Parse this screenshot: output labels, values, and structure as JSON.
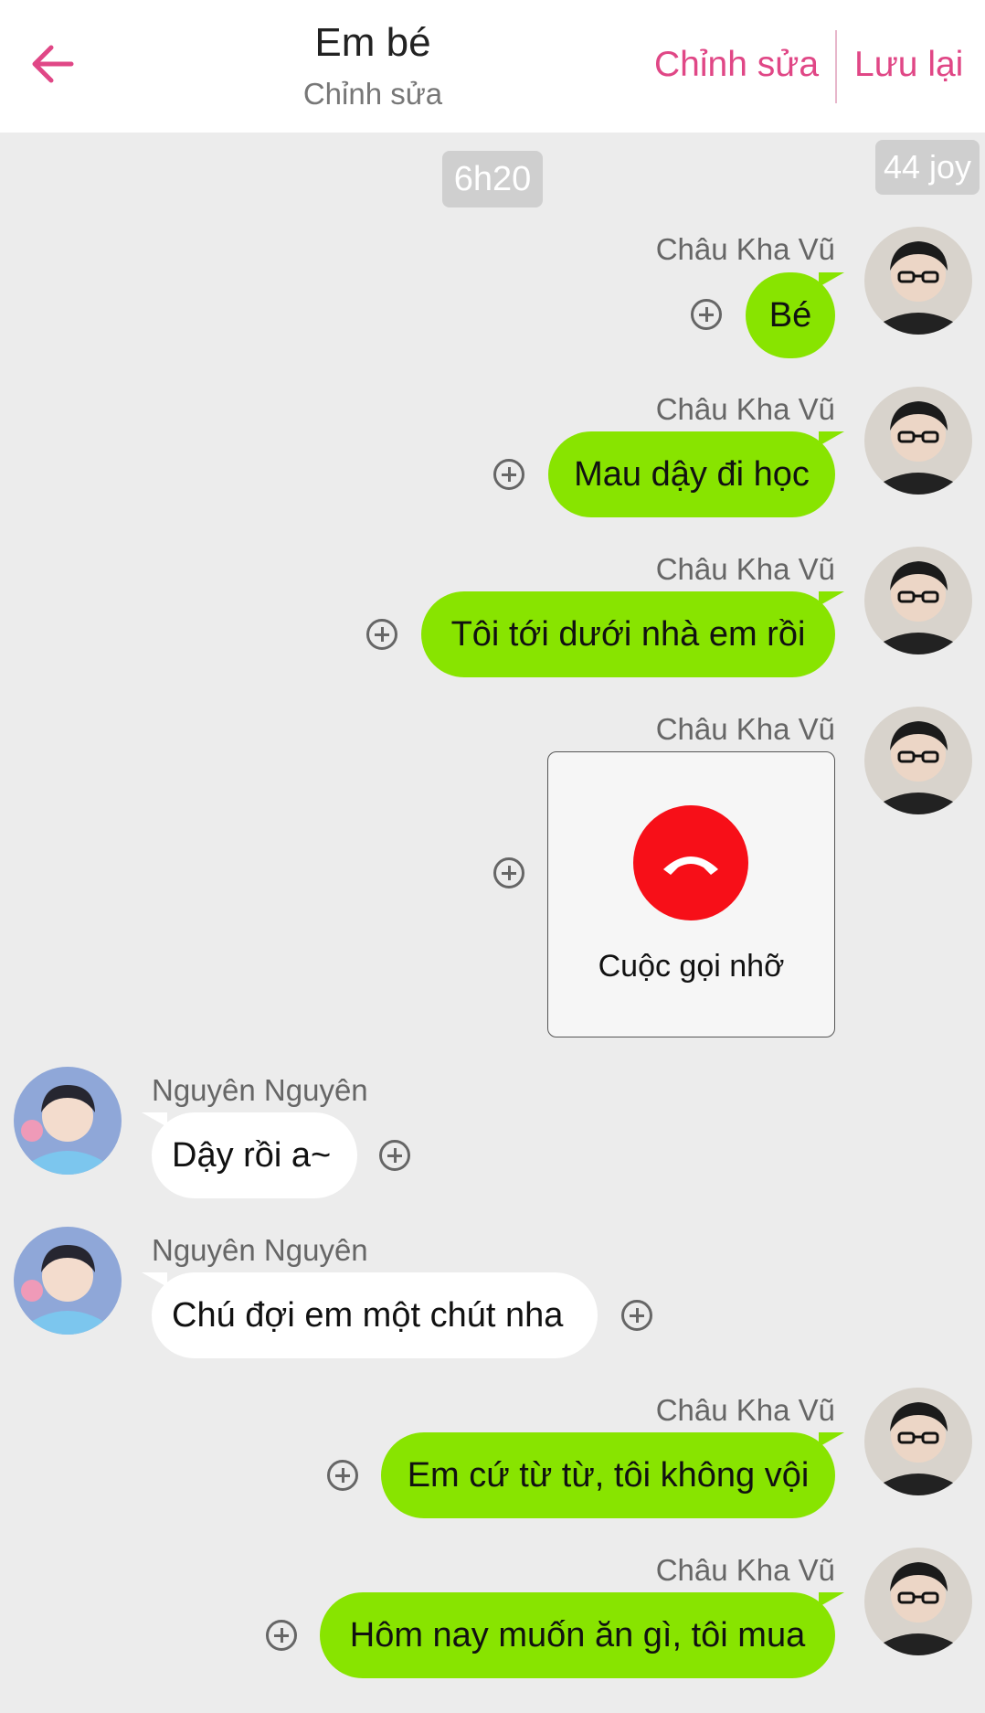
{
  "header": {
    "title": "Em bé",
    "subtitle": "Chỉnh sửa",
    "edit_label": "Chỉnh sửa",
    "save_label": "Lưu lại",
    "accent_color": "#e04786"
  },
  "chat": {
    "time_label": "6h20",
    "joy_label": "44 joy",
    "messages": [
      {
        "sender": "Châu Kha Vũ",
        "side": "right",
        "text": "Bé"
      },
      {
        "sender": "Châu Kha Vũ",
        "side": "right",
        "text": "Mau dậy đi học"
      },
      {
        "sender": "Châu Kha Vũ",
        "side": "right",
        "text": "Tôi tới dưới nhà em rồi"
      },
      {
        "sender": "Châu Kha Vũ",
        "side": "right",
        "type": "missed-call",
        "text": "Cuộc gọi nhỡ"
      },
      {
        "sender": "Nguyên Nguyên",
        "side": "left",
        "text": "Dậy rồi a~"
      },
      {
        "sender": "Nguyên Nguyên",
        "side": "left",
        "text": "Chú đợi em một chút nha"
      },
      {
        "sender": "Châu Kha Vũ",
        "side": "right",
        "text": "Em cứ từ từ, tôi không vội"
      },
      {
        "sender": "Châu Kha Vũ",
        "side": "right",
        "text": "Hôm nay muốn ăn gì, tôi mua"
      }
    ]
  },
  "colors": {
    "outgoing_bubble": "#88e400",
    "incoming_bubble": "#ffffff",
    "background": "#ececec",
    "missed_call": "#f70f18"
  }
}
